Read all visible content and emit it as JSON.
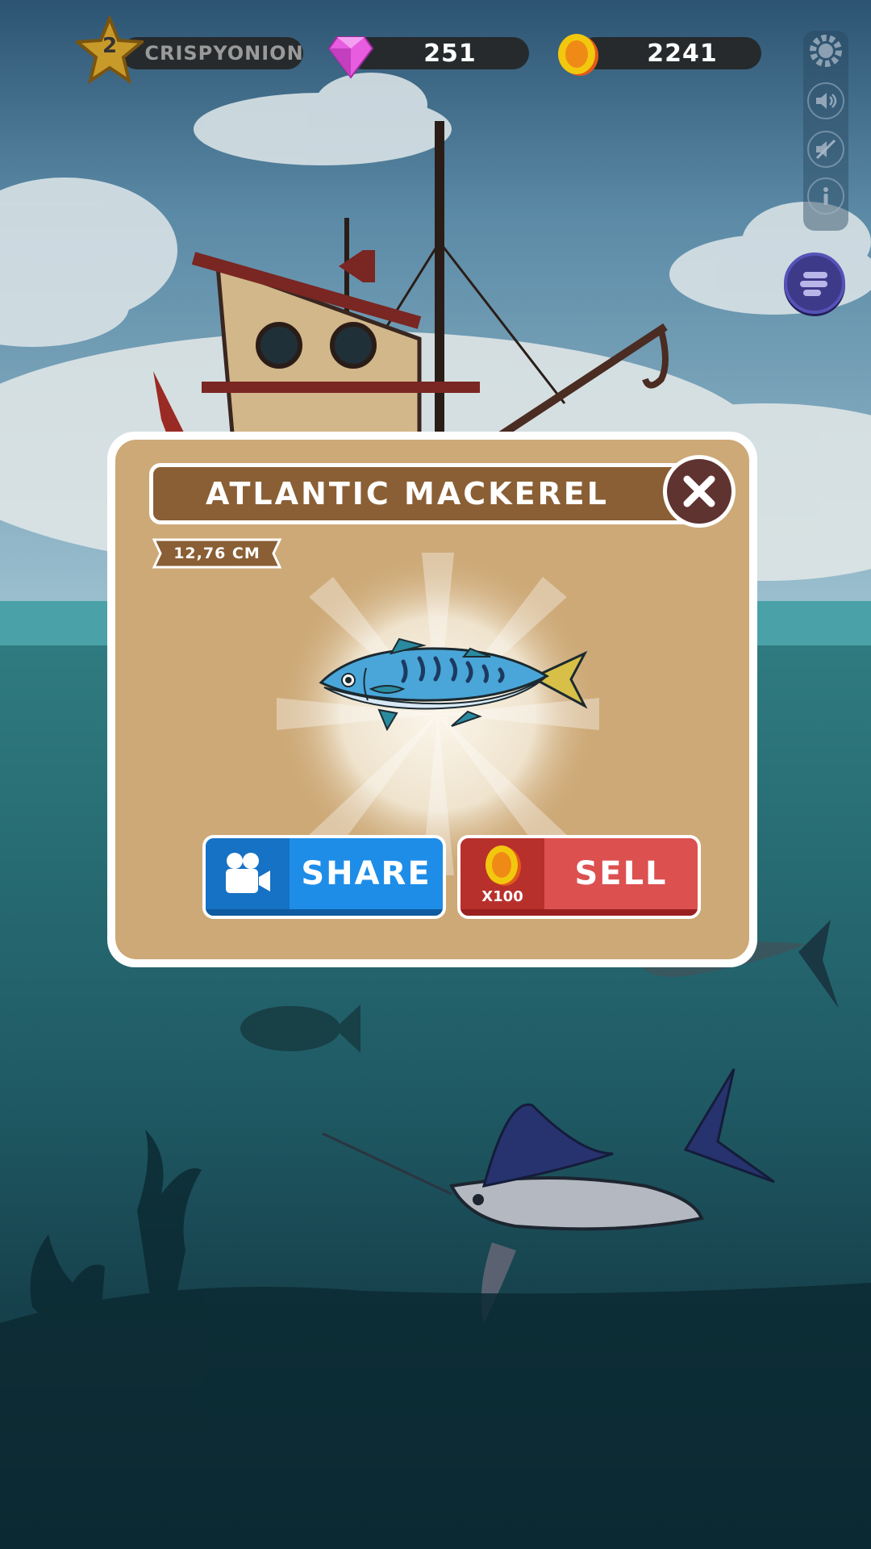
{
  "hud": {
    "level": "2",
    "username": "CRISPYONION",
    "gems": "251",
    "coins": "2241"
  },
  "side_panel": {
    "icons": [
      "gear-icon",
      "speaker-icon",
      "mute-icon",
      "info-icon"
    ],
    "menu_icon": "menu-icon"
  },
  "dialog": {
    "title": "ATLANTIC MACKEREL",
    "size": "12,76 CM",
    "fish_icon": "atlantic-mackerel",
    "share_label": "SHARE",
    "sell_label": "SELL",
    "sell_price": "X100"
  },
  "colors": {
    "share_button": "#1e8de8",
    "sell_button": "#dd5050",
    "dialog_bg": "#cda977",
    "title_bar": "#8a5f35"
  }
}
